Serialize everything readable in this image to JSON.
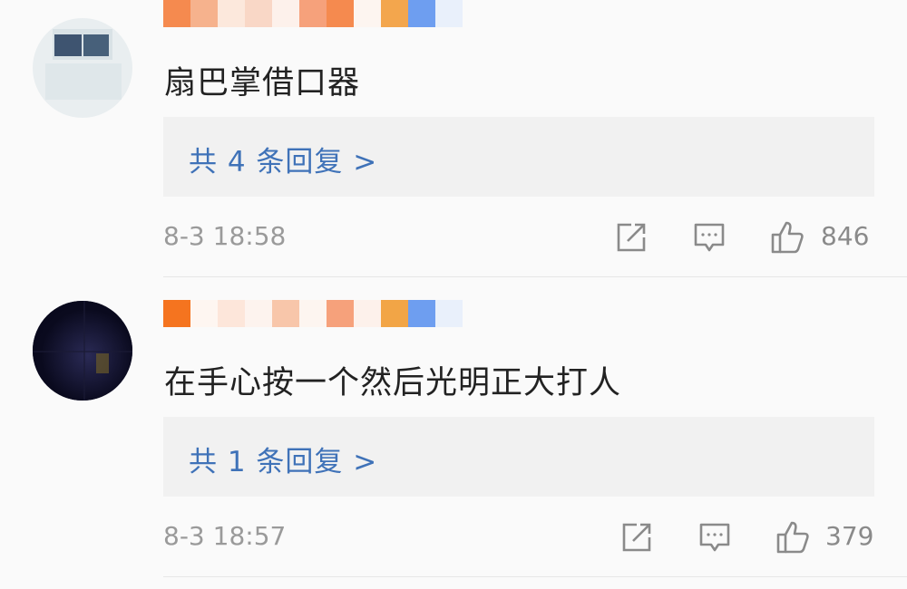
{
  "comments": [
    {
      "text": "扇巴掌借口器",
      "reply_link": "共 4 条回复 >",
      "time": "8-3 18:58",
      "likes": "846"
    },
    {
      "text": "在手心按一个然后光明正大打人",
      "reply_link": "共 1 条回复 >",
      "time": "8-3 18:57",
      "likes": "379"
    }
  ],
  "icons": {
    "share": "share-icon",
    "comment": "comment-icon",
    "like": "thumbs-up-icon"
  },
  "colors": {
    "link": "#3f72b8",
    "meta": "#9a9a9a",
    "text": "#222222"
  }
}
